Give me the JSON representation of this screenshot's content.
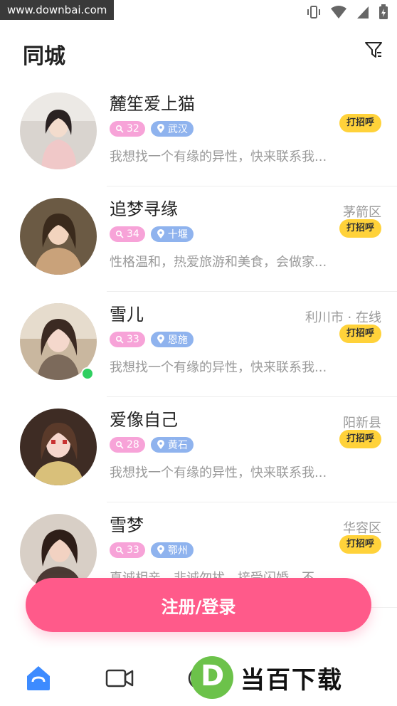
{
  "status_bar": {
    "watermark": "www.downbai.com"
  },
  "header": {
    "title": "同城"
  },
  "users": [
    {
      "name": "麓笙爱上猫",
      "age": "32",
      "city": "武汉",
      "location": "",
      "greet": "打招呼",
      "intro": "我想找一个有缘的异性，快来联系我...",
      "online": false
    },
    {
      "name": "追梦寻缘",
      "age": "34",
      "city": "十堰",
      "location": "茅箭区",
      "greet": "打招呼",
      "intro": "性格温和，热爱旅游和美食，会做家...",
      "online": false
    },
    {
      "name": "雪儿",
      "age": "33",
      "city": "恩施",
      "location": "利川市 · 在线",
      "greet": "打招呼",
      "intro": "我想找一个有缘的异性，快来联系我...",
      "online": true
    },
    {
      "name": "爱像自己",
      "age": "28",
      "city": "黄石",
      "location": "阳新县",
      "greet": "打招呼",
      "intro": "我想找一个有缘的异性，快来联系我...",
      "online": false
    },
    {
      "name": "雪梦",
      "age": "33",
      "city": "鄂州",
      "location": "华容区",
      "greet": "打招呼",
      "intro": "真诚相亲，非诚勿扰，接受闪婚，不...",
      "online": false
    }
  ],
  "register_button": "注册/登录",
  "brand": {
    "logo_letter": "D",
    "text": "当百下载"
  },
  "colors": {
    "accent": "#ff5a8a",
    "greet": "#ffd23a",
    "age_tag": "#f7a3d8",
    "city_tag": "#8fb3ee",
    "online": "#2fcf60"
  }
}
